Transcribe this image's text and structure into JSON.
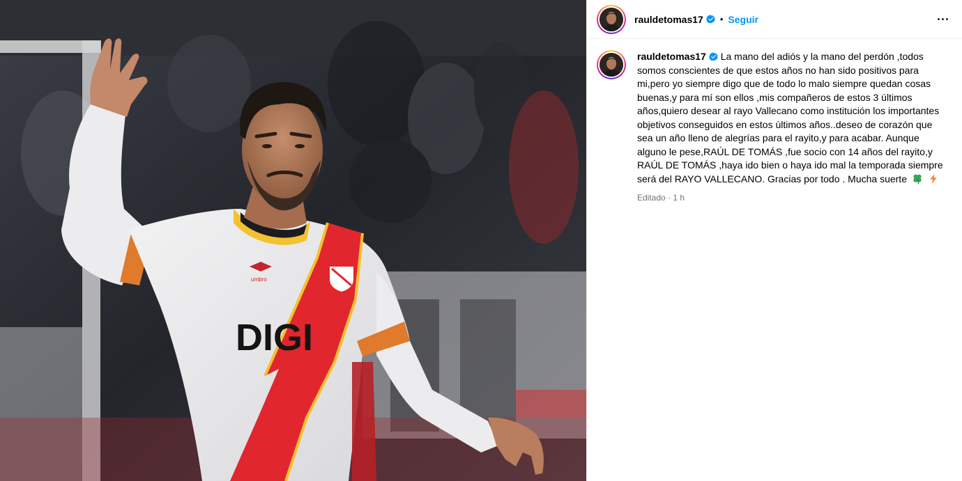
{
  "post": {
    "author": {
      "username": "rauldetomas17",
      "verified": true,
      "follow_label": "Seguir",
      "avatar_icon": "profile-avatar"
    },
    "caption": {
      "username": "rauldetomas17",
      "text": "La mano del adiós y la mano del perdón ,todos somos conscientes de que estos años no han sido positivos para mi,pero yo siempre digo que de todo lo malo siempre quedan cosas buenas,y para mí son ellos ,mis compañeros de estos 3 últimos años,quiero desear al rayo Vallecano como institución los importantes objetivos conseguidos en estos últimos años..deseo de corazón que sea un año lleno de alegrías para el rayito,y para acabar. Aunque alguno le pese,RAÚL DE TOMÁS ,fue socio con 14 años del rayito,y RAÚL DE TOMÁS ,haya ido bien o haya ido mal la temporada siempre será del RAYO VALLECANO. Gracias por todo . Mucha suerte",
      "emojis": [
        "four-leaf-clover-icon",
        "lightning-bolt-icon"
      ],
      "edited_label": "Editado",
      "time_ago": "1 h"
    },
    "photo": {
      "shirt_sponsor": "DIGI",
      "shirt_brand": "umbro"
    },
    "colors": {
      "link_blue": "#0095f6",
      "verified_blue": "#0095f6",
      "muted_text": "#737373",
      "shirt_red": "#e1262d",
      "shirt_white": "#eeeeef"
    }
  }
}
